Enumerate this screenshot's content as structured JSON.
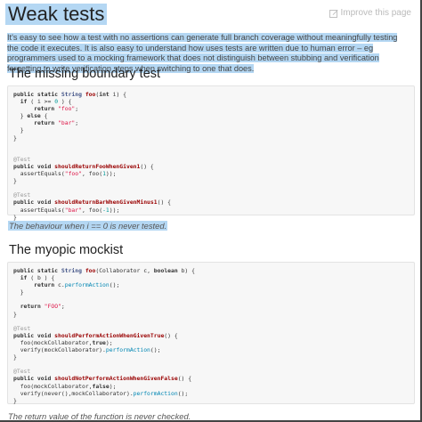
{
  "page": {
    "title": "Weak tests",
    "improve_link": "Improve this page",
    "intro": "It's easy to see how a test with no assertions can generate full branch coverage without meaningfully testing the code it executes. It is also easy to understand how uses tests are written due to human error – eg programmers used to a mocking framework that does not distinguish between stubbing and verification forgetting to write verification steps when switching to one that does."
  },
  "sections": [
    {
      "heading": "The missing boundary test",
      "code": [
        [
          [
            "public static ",
            "k"
          ],
          [
            "String ",
            "t"
          ],
          [
            "foo",
            "f"
          ],
          [
            "(",
            "m"
          ],
          [
            "int ",
            "k"
          ],
          [
            "i) {",
            "m"
          ]
        ],
        [
          [
            "  ",
            "m"
          ],
          [
            "if",
            "k"
          ],
          [
            " ( i >= ",
            "m"
          ],
          [
            "0",
            "n"
          ],
          [
            " ) {",
            "m"
          ]
        ],
        [
          [
            "      ",
            "m"
          ],
          [
            "return",
            "k"
          ],
          [
            " ",
            "m"
          ],
          [
            "\"foo\"",
            "s"
          ],
          [
            ";",
            "m"
          ]
        ],
        [
          [
            "  } ",
            "m"
          ],
          [
            "else",
            "k"
          ],
          [
            " {",
            "m"
          ]
        ],
        [
          [
            "      ",
            "m"
          ],
          [
            "return",
            "k"
          ],
          [
            " ",
            "m"
          ],
          [
            "\"bar\"",
            "s"
          ],
          [
            ";",
            "m"
          ]
        ],
        [
          [
            "  }",
            "m"
          ]
        ],
        [
          [
            "}",
            "m"
          ]
        ],
        [],
        [],
        [
          [
            "@Test",
            "a"
          ]
        ],
        [
          [
            "public void ",
            "k"
          ],
          [
            "shouldReturnFooWhenGiven1",
            "f"
          ],
          [
            "() {",
            "m"
          ]
        ],
        [
          [
            "  assertEquals(",
            "m"
          ],
          [
            "\"foo\"",
            "s"
          ],
          [
            ", foo(",
            "m"
          ],
          [
            "1",
            "n"
          ],
          [
            "));",
            "m"
          ]
        ],
        [
          [
            "}",
            "m"
          ]
        ],
        [],
        [
          [
            "@Test",
            "a"
          ]
        ],
        [
          [
            "public void ",
            "k"
          ],
          [
            "shouldReturnBarWhenGivenMinus1",
            "f"
          ],
          [
            "() {",
            "m"
          ]
        ],
        [
          [
            "  assertEquals(",
            "m"
          ],
          [
            "\"bar\"",
            "s"
          ],
          [
            ", foo(",
            "m"
          ],
          [
            "-1",
            "n"
          ],
          [
            "));",
            "m"
          ]
        ],
        [
          [
            "}",
            "m"
          ]
        ]
      ],
      "caption": "The behaviour when i == 0 is never tested."
    },
    {
      "heading": "The myopic mockist",
      "code": [
        [
          [
            "public static ",
            "k"
          ],
          [
            "String ",
            "t"
          ],
          [
            "foo",
            "f"
          ],
          [
            "(Collaborator c, ",
            "m"
          ],
          [
            "boolean ",
            "k"
          ],
          [
            "b) {",
            "m"
          ]
        ],
        [
          [
            "  ",
            "m"
          ],
          [
            "if",
            "k"
          ],
          [
            " ( b ) {",
            "m"
          ]
        ],
        [
          [
            "      ",
            "m"
          ],
          [
            "return",
            "k"
          ],
          [
            " c.",
            "m"
          ],
          [
            "performAction",
            "c"
          ],
          [
            "();",
            "m"
          ]
        ],
        [
          [
            "  }",
            "m"
          ]
        ],
        [],
        [
          [
            "  ",
            "m"
          ],
          [
            "return",
            "k"
          ],
          [
            " ",
            "m"
          ],
          [
            "\"FOO\"",
            "s"
          ],
          [
            ";",
            "m"
          ]
        ],
        [
          [
            "}",
            "m"
          ]
        ],
        [],
        [
          [
            "@Test",
            "a"
          ]
        ],
        [
          [
            "public void ",
            "k"
          ],
          [
            "shouldPerformActionWhenGivenTrue",
            "f"
          ],
          [
            "() {",
            "m"
          ]
        ],
        [
          [
            "  foo(mockCollaborator,",
            "m"
          ],
          [
            "true",
            "k"
          ],
          [
            ");",
            "m"
          ]
        ],
        [
          [
            "  verify(mockCollaborator).",
            "m"
          ],
          [
            "performAction",
            "c"
          ],
          [
            "();",
            "m"
          ]
        ],
        [
          [
            "}",
            "m"
          ]
        ],
        [],
        [
          [
            "@Test",
            "a"
          ]
        ],
        [
          [
            "public void ",
            "k"
          ],
          [
            "shouldNotPerformActionWhenGivenFalse",
            "f"
          ],
          [
            "() {",
            "m"
          ]
        ],
        [
          [
            "  foo(mockCollaborator,",
            "m"
          ],
          [
            "false",
            "k"
          ],
          [
            ");",
            "m"
          ]
        ],
        [
          [
            "  verify(never(),mockCollaborator).",
            "m"
          ],
          [
            "performAction",
            "c"
          ],
          [
            "();",
            "m"
          ]
        ],
        [
          [
            "}",
            "m"
          ]
        ]
      ],
      "caption": "The return value of the function is never checked."
    }
  ],
  "colors": {
    "selection": "#b4d7f3",
    "code_background": "#f7f7f7",
    "keyword": "#333333",
    "function_name": "#990000",
    "string": "#dd1144",
    "number": "#009999",
    "annotation": "#999999",
    "method_call": "#0086b3"
  },
  "icons": {
    "improve": "pencil-square-icon"
  }
}
